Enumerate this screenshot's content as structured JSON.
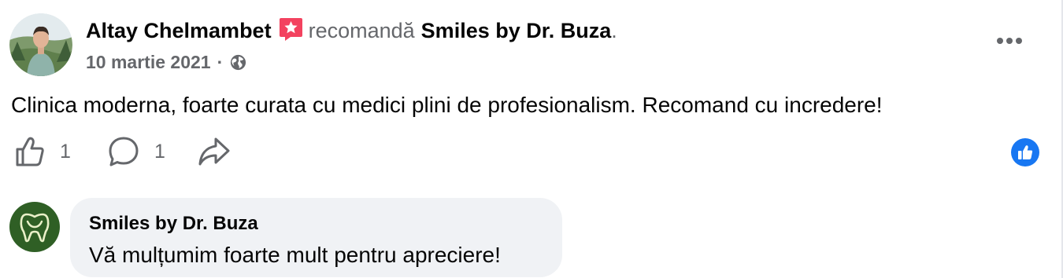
{
  "post": {
    "author": "Altay Chelmambet",
    "recommend_verb": "recomandă",
    "page_name": "Smiles by Dr. Buza",
    "period": ".",
    "date": "10 martie 2021",
    "meta_separator": "·",
    "privacy_icon": "globe-icon",
    "text": "Clinica moderna, foarte curata cu medici plini de profesionalism. Recomand cu incredere!"
  },
  "actions": {
    "like_count": "1",
    "comment_count": "1",
    "like_icon": "thumbs-up-outline-icon",
    "comment_icon": "speech-bubble-icon",
    "share_icon": "share-arrow-icon"
  },
  "reactions": {
    "icon": "like-reaction-icon"
  },
  "reply": {
    "author": "Smiles by Dr. Buza",
    "text": "Vă mulțumim foarte mult pentru apreciere!"
  },
  "colors": {
    "secondary_text": "#65676b",
    "recommend_badge": "#f3425f",
    "like_blue": "#1877f2",
    "bubble_bg": "#f0f2f5",
    "clinic_green": "#2f5f25"
  }
}
